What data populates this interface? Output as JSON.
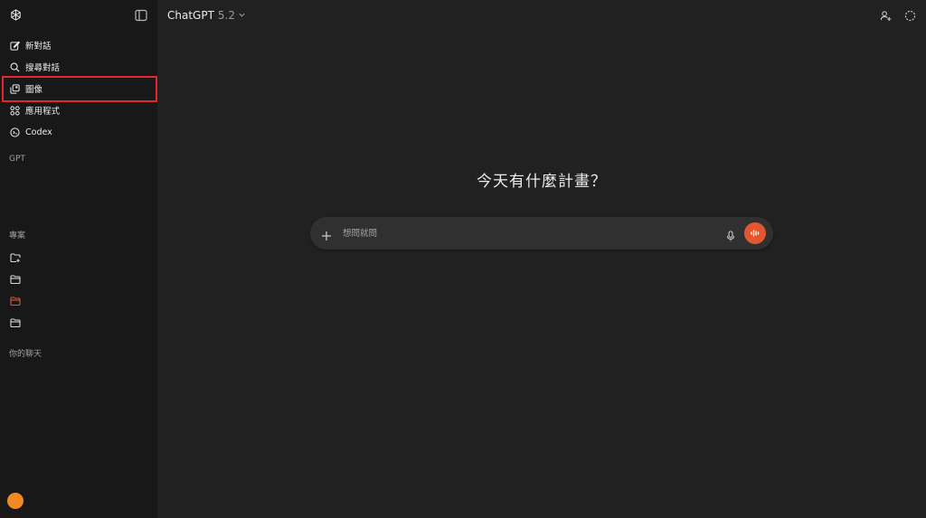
{
  "sidebar": {
    "nav": [
      {
        "label": "新對話",
        "icon": "edit-icon"
      },
      {
        "label": "搜尋對話",
        "icon": "search-icon"
      },
      {
        "label": "圖像",
        "icon": "images-icon"
      },
      {
        "label": "應用程式",
        "icon": "apps-icon"
      },
      {
        "label": "Codex",
        "icon": "codex-icon"
      }
    ],
    "gpt_label": "GPT",
    "projects_label": "專案",
    "projects": [
      {
        "icon": "new-project-folder-icon",
        "color": "#d9d9d9"
      },
      {
        "icon": "folder-icon",
        "color": "#d9d9d9"
      },
      {
        "icon": "folder-icon",
        "color": "#e4572e"
      },
      {
        "icon": "folder-icon",
        "color": "#d9d9d9"
      }
    ],
    "chats_label": "你的聊天",
    "avatar_color": "#f28a23"
  },
  "header": {
    "model_name": "ChatGPT",
    "model_version": "5.2"
  },
  "main": {
    "greeting": "今天有什麼計畫？",
    "composer": {
      "placeholder": "想問就問"
    }
  },
  "colors": {
    "accent": "#e4572e",
    "highlight_box": "#e5262a",
    "sidebar_bg": "#181818",
    "main_bg": "#212121"
  }
}
